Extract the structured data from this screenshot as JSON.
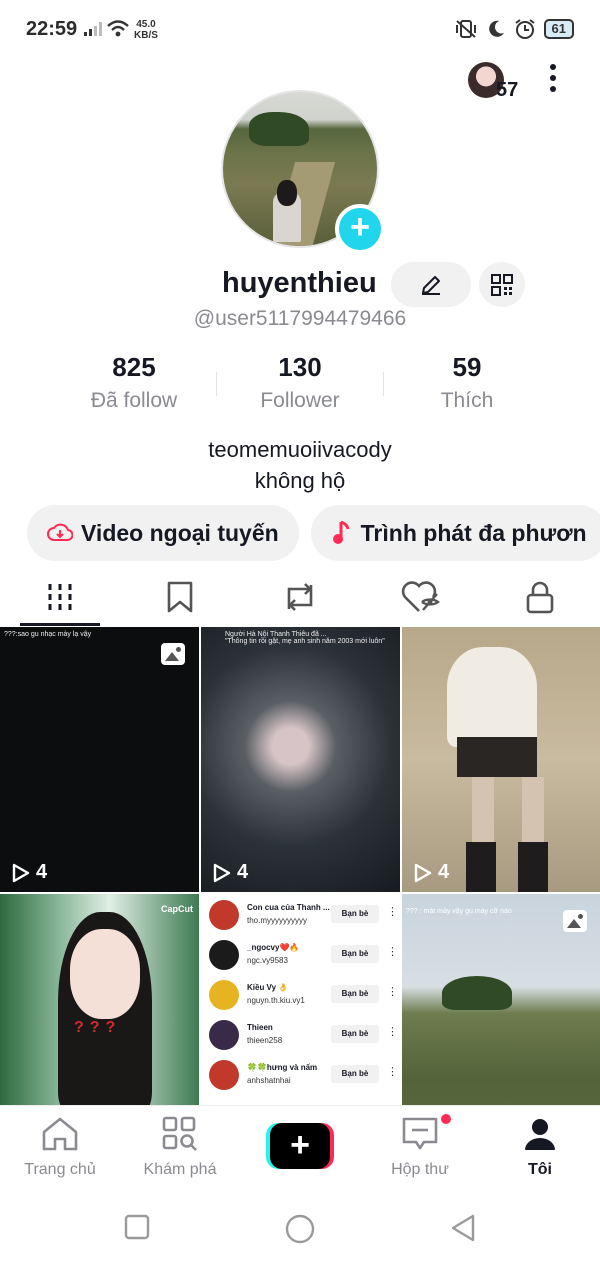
{
  "status_bar": {
    "time": "22:59",
    "net_speed_value": "45.0",
    "net_speed_unit": "KB/S",
    "battery": "61"
  },
  "top": {
    "avatar_count": "57",
    "avatar_icon": "profile-switch-avatar",
    "more_icon": "more-vertical-icon"
  },
  "profile": {
    "username": "huyenthieu",
    "handle": "@user5117994479466",
    "bio_line1": "teomemuoiivacody",
    "bio_line2": "không hộ"
  },
  "stats": [
    {
      "value": "825",
      "label": "Đã follow"
    },
    {
      "value": "130",
      "label": "Follower"
    },
    {
      "value": "59",
      "label": "Thích"
    }
  ],
  "chips": [
    {
      "label": "Video ngoại tuyến",
      "icon": "cloud-download-icon"
    },
    {
      "label": "Trình phát đa phươn",
      "icon": "music-note-icon"
    }
  ],
  "tabs": [
    {
      "name": "videos",
      "icon": "grid-bars-icon"
    },
    {
      "name": "favorites",
      "icon": "bookmark-icon"
    },
    {
      "name": "reposts",
      "icon": "repost-icon"
    },
    {
      "name": "liked",
      "icon": "liked-heart-icon"
    },
    {
      "name": "private",
      "icon": "lock-icon"
    }
  ],
  "grid": {
    "c1": {
      "caption": "???:sao gu nhạc mày lạ vậy",
      "views": "4"
    },
    "c2": {
      "caption_line1": "Người Hà Nội Thanh Thiêu đã ...",
      "caption_line2": "\"Thông tin rồi gặt, mẹ anh sinh năm 2003 mới luôn\"",
      "views": "4"
    },
    "c3": {
      "views": "4"
    },
    "c4": {
      "brand": "CapCut",
      "marks": "???"
    },
    "c5": {
      "rows": [
        {
          "name": "Con cua của Thanh ...",
          "handle": "tho.myyyyyyyyyy",
          "button": "Bạn bè",
          "color": "#c0392b"
        },
        {
          "name": "_ngocvy❤️🔥",
          "handle": "ngc.vy9583",
          "button": "Bạn bè",
          "color": "#1b1b1b"
        },
        {
          "name": "Kiều Vy 👌",
          "handle": "nguyn.th.kiu.vy1",
          "button": "Bạn bè",
          "color": "#e6b422"
        },
        {
          "name": "Thieen",
          "handle": "thieen258",
          "button": "Bạn bè",
          "color": "#3a2a4a"
        },
        {
          "name": "🍀🍀hưng và nấm",
          "handle": "anhshatnhai",
          "button": "Bạn bè",
          "color": "#c0392b"
        }
      ]
    },
    "c6": {
      "caption": "??? : mát mày vậy gu mày cỡ nào"
    }
  },
  "bottom_nav": [
    {
      "label": "Trang chủ",
      "icon": "home-icon"
    },
    {
      "label": "Khám phá",
      "icon": "discover-icon"
    },
    {
      "label": "",
      "icon": "create-plus-icon"
    },
    {
      "label": "Hộp thư",
      "icon": "inbox-icon"
    },
    {
      "label": "Tôi",
      "icon": "profile-icon"
    }
  ]
}
